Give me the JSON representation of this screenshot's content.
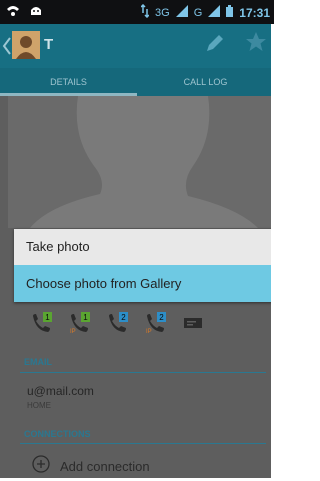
{
  "status_bar": {
    "network_left": "3G",
    "network_right": "G",
    "time": "17:31"
  },
  "action_bar": {
    "contact_name": "T"
  },
  "tabs": [
    {
      "label": "DETAILS"
    },
    {
      "label": "CALL LOG"
    }
  ],
  "popup_menu": {
    "items": [
      {
        "label": "Take photo"
      },
      {
        "label": "Choose photo from Gallery"
      }
    ],
    "selected_index": 1
  },
  "email_section": {
    "header": "EMAIL",
    "value": "u@mail.com",
    "type": "HOME"
  },
  "connections_section": {
    "header": "CONNECTIONS",
    "add_label": "Add connection"
  },
  "call_actions": [
    {
      "icon": "phone-sim1-icon",
      "sim": "1"
    },
    {
      "icon": "phone-ip-sim1-icon",
      "sim": "1",
      "badge": "IP"
    },
    {
      "icon": "phone-sim2-icon",
      "sim": "2"
    },
    {
      "icon": "phone-ip-sim2-icon",
      "sim": "2",
      "badge": "IP"
    },
    {
      "icon": "message-icon"
    }
  ],
  "colors": {
    "action_bar": "#176f83",
    "accent": "#2a7891",
    "selected": "#6ec9e3",
    "sim1": "#5aa531",
    "sim2": "#2d8ec8",
    "ip": "#d97b2a"
  }
}
